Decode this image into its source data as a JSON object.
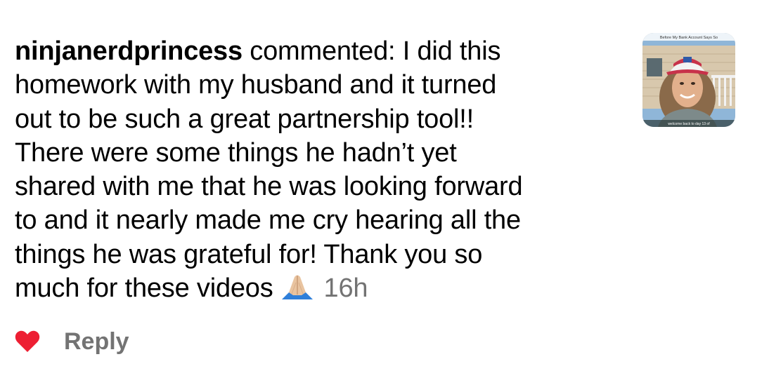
{
  "comment": {
    "username": "ninjanerdprincess",
    "action": "commented:",
    "text_lines": [
      "I did this",
      "homework with my husband and it turned",
      "out to be such a great partnership tool!!",
      "There were some things he hadn’t yet",
      "shared with me that he was looking forward",
      "to and it nearly made me cry hearing all the",
      "things he was grateful for! Thank you so",
      "much for these videos"
    ],
    "emoji": "folded-hands",
    "timestamp": "16h"
  },
  "thumbnail": {
    "caption_top": "Before My Bank Account Says So",
    "caption_bottom": "welcome back to day 13 of"
  },
  "actions": {
    "like_icon": "heart-icon",
    "like_color": "#ed1f33",
    "reply_label": "Reply"
  },
  "colors": {
    "text": "#000000",
    "secondary": "#737373"
  }
}
